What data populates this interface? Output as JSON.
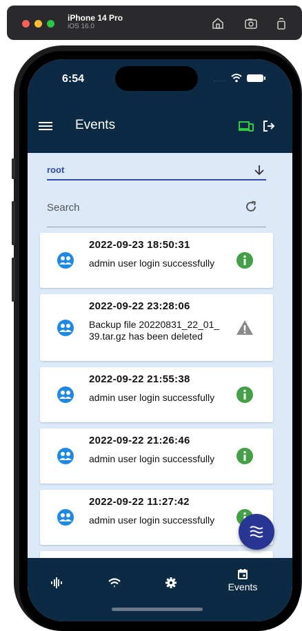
{
  "simulator": {
    "device_name": "iPhone 14 Pro",
    "os_version": "iOS 16.0"
  },
  "status_bar": {
    "time": "6:54",
    "signal_dots": "....."
  },
  "app_bar": {
    "title": "Events",
    "device_icon_color": "#2ecc40"
  },
  "filter": {
    "selected": "root"
  },
  "search": {
    "placeholder": "Search"
  },
  "events": [
    {
      "date": "2022-09-23 18:50:31",
      "message": "admin user login successfully",
      "level": "info"
    },
    {
      "date": "2022-09-22 23:28:06",
      "message": "Backup file 20220831_22_01_39.tar.gz has been deleted",
      "level": "warning"
    },
    {
      "date": "2022-09-22 21:55:38",
      "message": "admin user login successfully",
      "level": "info"
    },
    {
      "date": "2022-09-22 21:26:46",
      "message": "admin user login successfully",
      "level": "info"
    },
    {
      "date": "2022-09-22 11:27:42",
      "message": "admin user login successfully",
      "level": "info"
    }
  ],
  "colors": {
    "primary_dark": "#0d2a45",
    "accent_blue": "#1e88e5",
    "info_green": "#43a047",
    "warning_grey": "#8a8a8a",
    "fab": "#283593"
  },
  "bottom_nav": {
    "items": [
      {
        "name": "dashboard",
        "label": ""
      },
      {
        "name": "network",
        "label": ""
      },
      {
        "name": "settings",
        "label": ""
      },
      {
        "name": "events",
        "label": "Events"
      }
    ]
  }
}
